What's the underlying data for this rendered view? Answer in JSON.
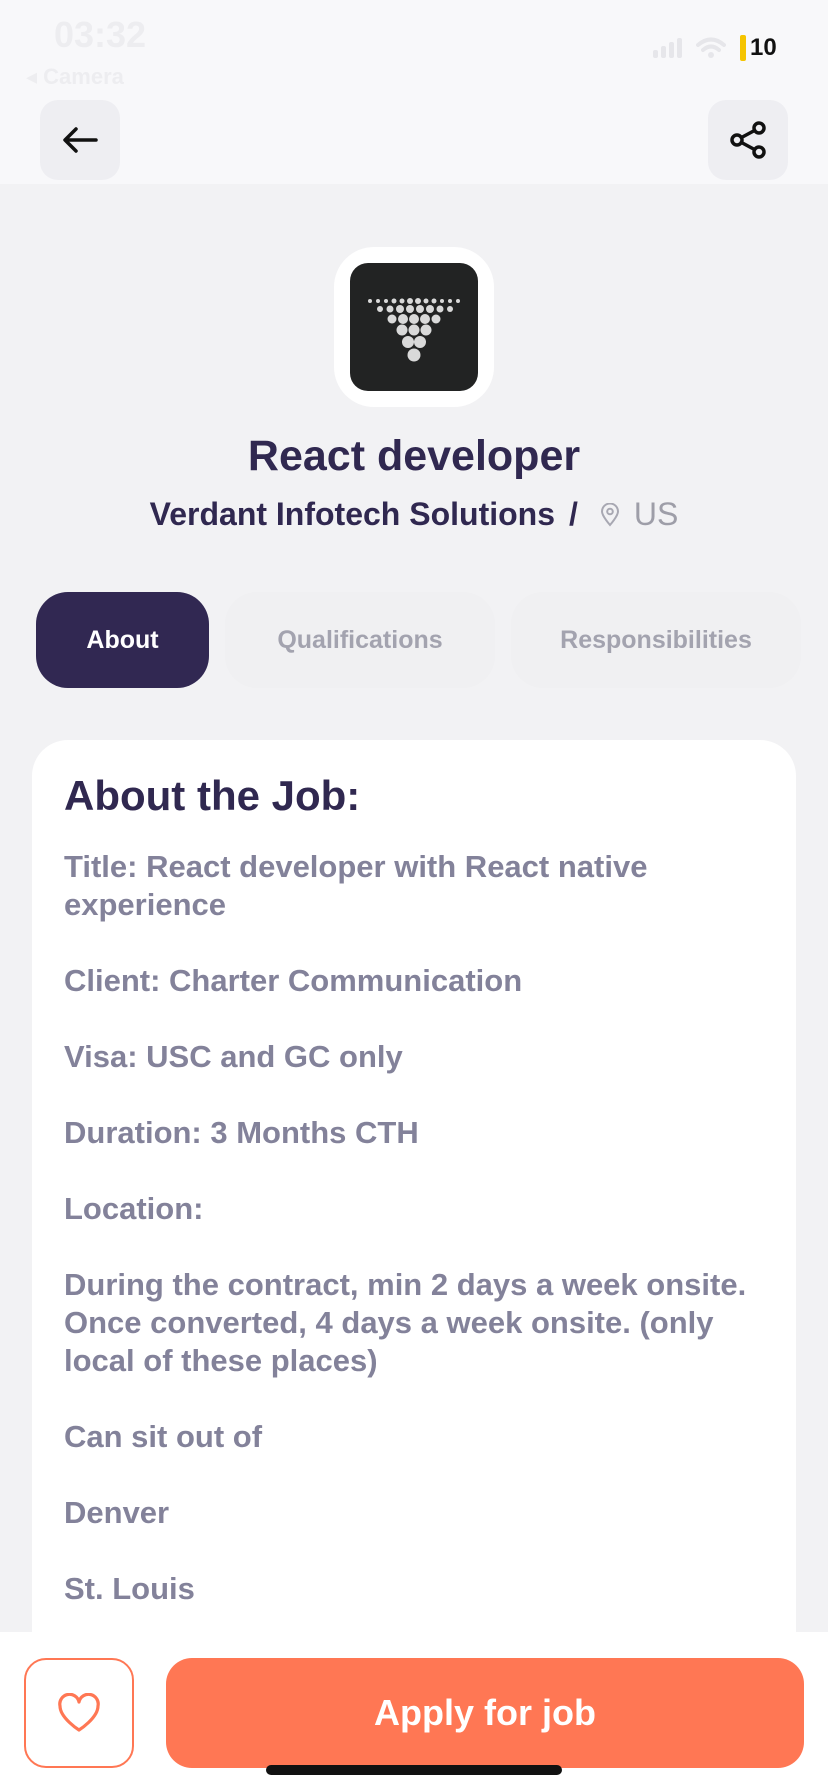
{
  "status_bar": {
    "time": "03:32",
    "back_app": "◂ Camera",
    "battery": "10"
  },
  "header": {
    "back_icon": "arrow-left-icon",
    "share_icon": "share-icon"
  },
  "job": {
    "title": "React developer",
    "company": "Verdant Infotech Solutions",
    "separator": "/",
    "location": "US"
  },
  "tabs": [
    {
      "label": "About",
      "active": true
    },
    {
      "label": "Qualifications",
      "active": false
    },
    {
      "label": "Responsibilities",
      "active": false
    }
  ],
  "about": {
    "heading": "About the Job:",
    "paragraphs": [
      "Title: React developer with React native experience",
      "Client: Charter Communication",
      "Visa: USC and GC only",
      "Duration: 3 Months CTH",
      "Location:",
      "During the contract, min 2 days a week onsite. Once converted, 4 days a week onsite. (only local of these places)",
      "Can sit out of",
      "Denver",
      "St. Louis"
    ]
  },
  "footer": {
    "favorite_icon": "heart-icon",
    "apply_label": "Apply for job"
  },
  "colors": {
    "primary": "#312852",
    "accent": "#FF7754",
    "muted_text": "#83829A",
    "background": "#F2F2F4"
  }
}
